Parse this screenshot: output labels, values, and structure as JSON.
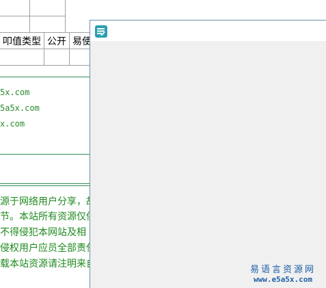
{
  "background": {
    "type_table": {
      "headers": [
        "叩值类型",
        "公开",
        "易使"
      ]
    },
    "urls": [
      "5x.com",
      "5a5x.com",
      "x.com"
    ],
    "notice_lines": [
      "源于网络用户分享，故",
      "节。本站所有资源仅供",
      "  不得侵犯本网站及相",
      "侵权用户应员全部责任",
      "载本站资源请注明来自"
    ]
  },
  "app_window": {
    "icon": "app-logo-icon",
    "accent": "#2a9fb0"
  },
  "watermark": {
    "name": "易语言资源网",
    "url": "www.e5a5x.com"
  }
}
